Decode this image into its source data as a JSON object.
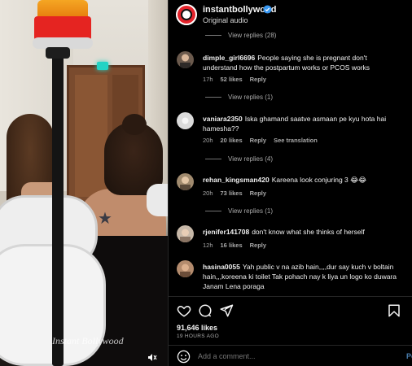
{
  "post": {
    "username": "instantbollywood",
    "subtitle": "Original audio",
    "likes": "91,646 likes",
    "time": "19 HOURS AGO",
    "watermark": "Instant Bollywood"
  },
  "comments": [
    {
      "username": "dimple_girl6696",
      "text": "People saying she is pregnant don't understand how the postpartum works or PCOS works",
      "time": "17h",
      "likes": "52 likes",
      "reply": "Reply",
      "view_replies": "View replies (1)"
    },
    {
      "username": "vaniara2350",
      "text": "Iska ghamand saatve asmaan pe kyu hota hai hamesha??",
      "time": "20h",
      "likes": "20 likes",
      "reply": "Reply",
      "translation": "See translation",
      "view_replies": "View replies (4)"
    },
    {
      "username": "rehan_kingsman420",
      "text": "Kareena look conjuring 3 😂😂",
      "time": "20h",
      "likes": "73 likes",
      "reply": "Reply",
      "view_replies": "View replies (1)"
    },
    {
      "username": "rjenifer141708",
      "text": "don't know what she thinks of herself",
      "time": "12h",
      "likes": "16 likes",
      "reply": "Reply"
    },
    {
      "username": "hasina0055",
      "text": "Yah public v na azib hain,,,,dur say kuch v boltain hain,,,koreena ki toilet Tak pohach nay k liya un logo ko duwara Janam Lena poraga"
    }
  ],
  "top_view_replies": "View replies (28)",
  "add_comment": {
    "placeholder": "Add a comment...",
    "post_label": "Po"
  },
  "colors": {
    "background": "#000000",
    "secondary_text": "#a8a8a8",
    "verified": "#3897f0",
    "brand_red": "#e4232b",
    "post_blue": "#4a7fb0"
  }
}
